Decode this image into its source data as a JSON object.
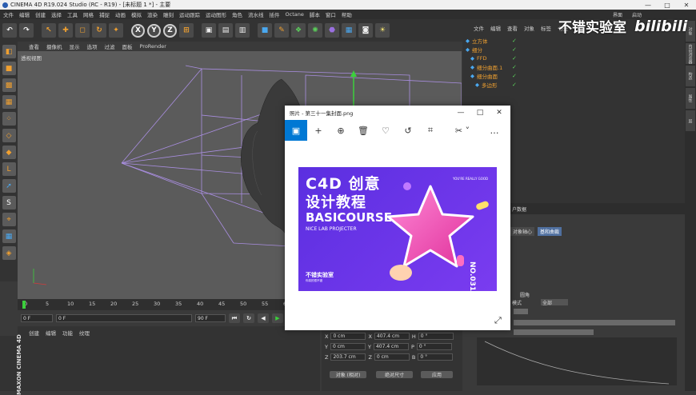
{
  "window": {
    "title": "CINEMA 4D R19.024 Studio (RC - R19) - [未标题 1 *] - 主要",
    "minimize": "—",
    "maximize": "□",
    "close": "✕"
  },
  "menubar": [
    "文件",
    "编辑",
    "创建",
    "选择",
    "工具",
    "网格",
    "捕捉",
    "动画",
    "模拟",
    "渲染",
    "雕刻",
    "运动跟踪",
    "运动图形",
    "角色",
    "流水线",
    "插件",
    "Octane",
    "脚本",
    "窗口",
    "帮助"
  ],
  "layout_label": "界面",
  "layout_value": "启动",
  "toolbar": {
    "undo": "↶",
    "redo": "↷",
    "x": "X",
    "y": "Y",
    "z": "Z"
  },
  "viewport": {
    "menu": [
      "查看",
      "摄像机",
      "显示",
      "选项",
      "过滤",
      "面板",
      "ProRender"
    ],
    "label": "透视视图"
  },
  "timeline": {
    "ticks": [
      "0",
      "5",
      "10",
      "15",
      "20",
      "25",
      "30",
      "35",
      "40",
      "45",
      "50",
      "55",
      "60"
    ],
    "start_field": "0 F",
    "current_field": "0 F",
    "end_field": "90 F",
    "end_field2": "90 F"
  },
  "material_manager": {
    "menu": [
      "创建",
      "编辑",
      "功能",
      "纹理"
    ]
  },
  "maxon": {
    "brand": "MAXON",
    "product": "CINEMA 4D"
  },
  "coordinates": {
    "rows": [
      {
        "axis": "X",
        "pos": "0 cm",
        "size_axis": "X",
        "size": "407.4 cm",
        "rot_axis": "H",
        "rot": "0 °"
      },
      {
        "axis": "Y",
        "pos": "0 cm",
        "size_axis": "Y",
        "size": "407.4 cm",
        "rot_axis": "P",
        "rot": "0 °"
      },
      {
        "axis": "Z",
        "pos": "203.7 cm",
        "size_axis": "Z",
        "size": "0 cm",
        "rot_axis": "B",
        "rot": "0 °"
      }
    ],
    "mode_dropdown": "对象 (相对)",
    "size_dropdown": "绝对尺寸",
    "apply_button": "应用"
  },
  "object_manager": {
    "menu": [
      "文件",
      "编辑",
      "查看",
      "对象",
      "标签",
      "书签"
    ],
    "objects": [
      {
        "name": "立方体",
        "indent": 0
      },
      {
        "name": "细分",
        "indent": 0
      },
      {
        "name": "FFD",
        "indent": 1
      },
      {
        "name": "细分曲面.1",
        "indent": 1
      },
      {
        "name": "细分曲面",
        "indent": 1
      },
      {
        "name": "多边形",
        "indent": 2
      }
    ]
  },
  "attribute_manager": {
    "header": "户数据",
    "tabs": [
      "对象轴心",
      "基和曲裁"
    ],
    "active_tab": 1,
    "labels": [
      "圆角",
      "模式",
      "全部"
    ]
  },
  "right_tabs": [
    "对象",
    "内容浏览器",
    "构造",
    "属性",
    "层"
  ],
  "watermark": {
    "text": "不错实验室",
    "bili": "bilibili"
  },
  "photos": {
    "title": "照片 - 第三十一集封面.png",
    "image": {
      "line1": "C4D 创意",
      "line2": "设计教程",
      "line3": "BASICOURSE",
      "line4": "NICE LAB PROJECTER",
      "tagline": "YOU'RE REALLY GOOD",
      "brand": "不错实验室",
      "brand_sub": "你真的很不错",
      "episode": "NO.031"
    }
  }
}
